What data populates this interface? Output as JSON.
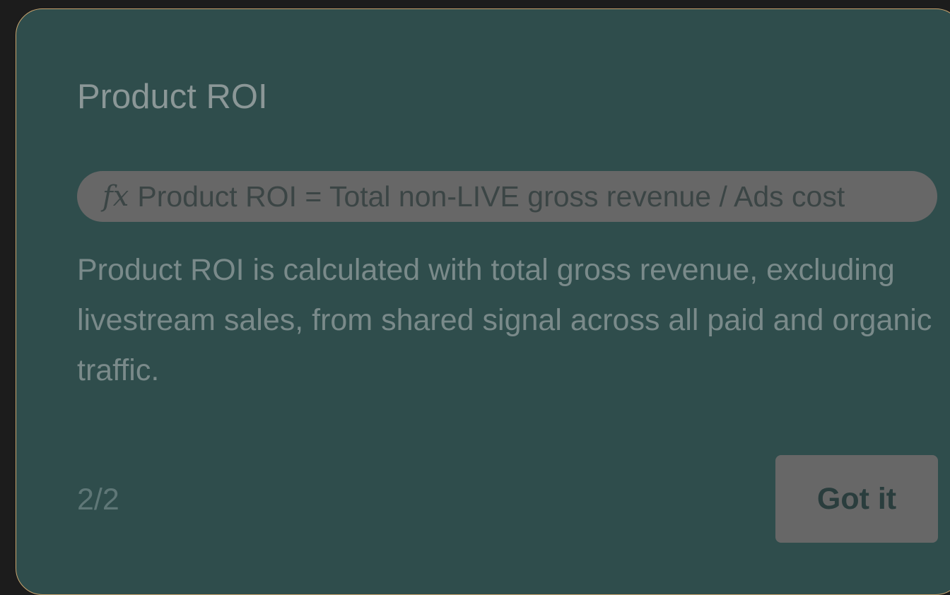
{
  "tooltip": {
    "title": "Product ROI",
    "formula": {
      "icon": "fx-icon",
      "symbol": "fx",
      "text": "Product ROI = Total non-LIVE gross revenue / Ads cost"
    },
    "description": "Product ROI is calculated with total gross revenue, excluding livestream sales, from shared signal across all paid and organic traffic.",
    "step": "2/2",
    "button_label": "Got it"
  },
  "colors": {
    "card_background": "#2f4d4c",
    "card_border": "#c9a46e",
    "pill_background": "#676767",
    "button_background": "#676767",
    "page_background": "#1c1c1c"
  }
}
